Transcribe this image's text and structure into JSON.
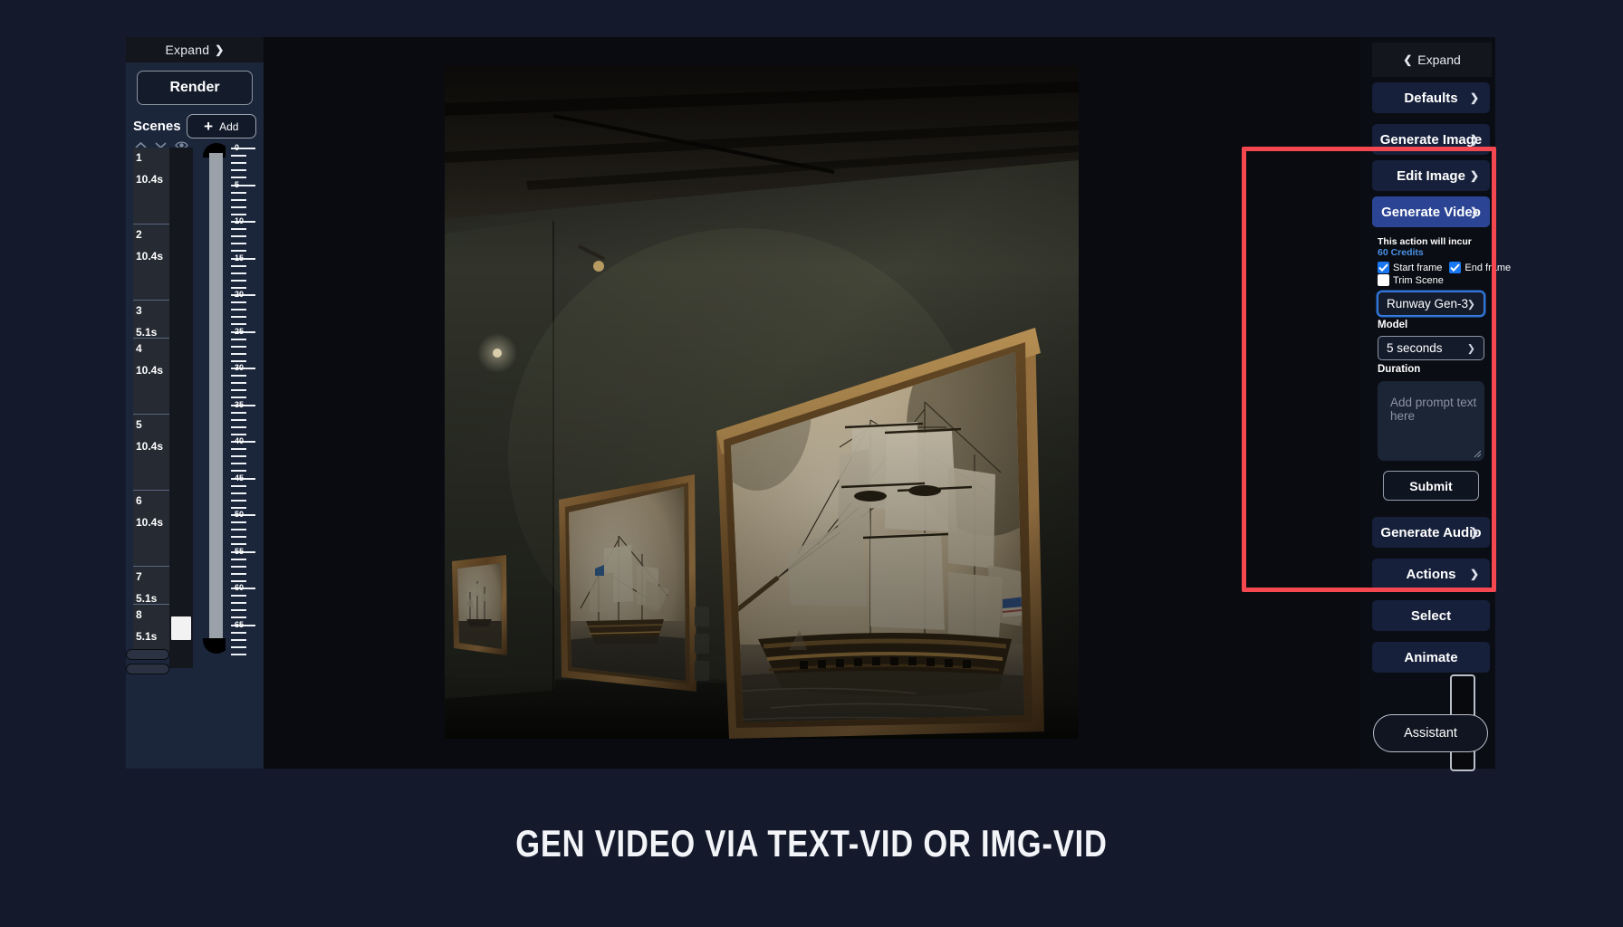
{
  "caption": "GEN VIDEO VIA TEXT-VID OR IMG-VID",
  "left_sidebar": {
    "expand_label": "Expand",
    "expand_chevron": "chevron-right-icon",
    "render_label": "Render",
    "scenes_label": "Scenes",
    "add_label": "Add",
    "add_plus": "+",
    "tools": [
      "sort-up-icon",
      "sort-down-icon",
      "eye-icon"
    ],
    "scenes": [
      {
        "number": "1",
        "duration": "10.4s"
      },
      {
        "number": "2",
        "duration": "10.4s"
      },
      {
        "number": "3",
        "duration": "5.1s"
      },
      {
        "number": "4",
        "duration": "10.4s"
      },
      {
        "number": "5",
        "duration": "10.4s"
      },
      {
        "number": "6",
        "duration": "10.4s"
      },
      {
        "number": "7",
        "duration": "5.1s"
      },
      {
        "number": "8",
        "duration": "5.1s"
      }
    ],
    "ruler_labels": [
      "0",
      "5",
      "10",
      "15",
      "20",
      "25",
      "30",
      "35",
      "40",
      "45",
      "50",
      "55",
      "60",
      "65"
    ]
  },
  "right_sidebar": {
    "expand_label": "Expand",
    "expand_chevron": "chevron-left-icon",
    "panels": [
      {
        "label": "Defaults",
        "accent": false
      },
      {
        "label": "Generate Image",
        "accent": false
      },
      {
        "label": "Edit Image",
        "accent": false
      },
      {
        "label": "Generate Video",
        "accent": true
      },
      {
        "label": "Generate Audio",
        "accent": false
      },
      {
        "label": "Actions",
        "accent": false
      },
      {
        "label": "Select",
        "accent": false
      },
      {
        "label": "Animate",
        "accent": false
      }
    ],
    "generate_video": {
      "credits_prefix": "This action will incur ",
      "credits_value": "60 Credits",
      "checkboxes": [
        {
          "label": "Start frame",
          "checked": true
        },
        {
          "label": "End frame",
          "checked": true
        },
        {
          "label": "Trim Scene",
          "checked": false
        }
      ],
      "model_value": "Runway Gen-3",
      "model_label": "Model",
      "duration_value": "5 seconds",
      "duration_label": "Duration",
      "prompt_placeholder": "Add prompt text here",
      "submit_label": "Submit"
    },
    "assistant_label": "Assistant"
  },
  "colors": {
    "page_bg": "#141a2b",
    "panel_bg": "#16203a",
    "panel_accent": "#2c4494",
    "highlight_box": "#f4474f",
    "checkbox_blue": "#1877f2",
    "credits_link": "#4a90e2"
  }
}
